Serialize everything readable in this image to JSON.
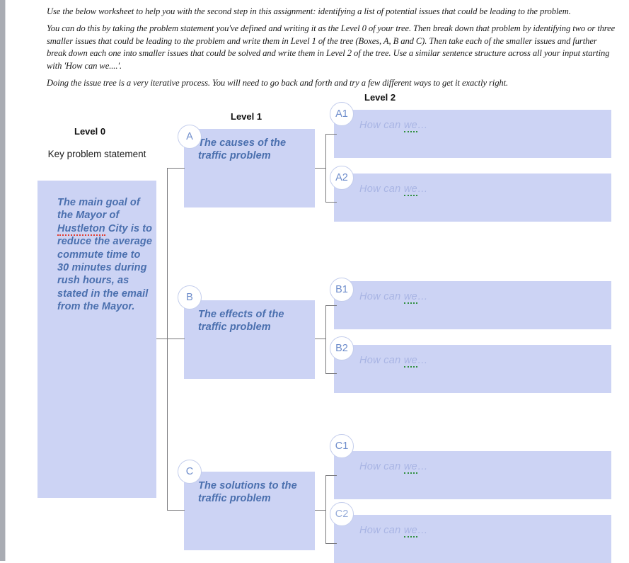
{
  "document": {
    "instructions": [
      "Use the below worksheet to help you with the second step in this assignment: identifying a list of potential issues that could be leading to the problem.",
      "You can do this by taking the problem statement you've defined and writing it as the Level 0 of your tree. Then break down that problem by identifying two or three smaller issues that could be leading to the problem and write them in Level 1 of the tree (Boxes, A, B and C). Then take each of the smaller issues and further break down each one into smaller issues that could be solved and write them in Level 2 of the tree. Use a similar sentence structure across all your input starting with 'How can we....'.",
      "Doing the issue tree is a very iterative process. You will need to go back and forth and try a few different ways to get it exactly right."
    ]
  },
  "tree": {
    "columns": {
      "level0_label": "Level 0",
      "level0_sublabel": "Key problem statement",
      "level1_label": "Level 1",
      "level2_label": "Level 2"
    },
    "level0": {
      "text_before": "The main goal of the Mayor of ",
      "misspelled_word": "Hustleton",
      "text_after": " City is to reduce the average commute time to 30 minutes during rush hours, as stated in the email from the Mayor."
    },
    "level1": [
      {
        "badge": "A",
        "text": "The causes of the traffic problem"
      },
      {
        "badge": "B",
        "text": "The effects of the traffic problem"
      },
      {
        "badge": "C",
        "text": "The solutions to the traffic problem"
      }
    ],
    "level2": [
      {
        "badge": "A1",
        "placeholder_start": "How can ",
        "placeholder_flagged": "we",
        "placeholder_end": "…"
      },
      {
        "badge": "A2",
        "placeholder_start": "How can ",
        "placeholder_flagged": "we",
        "placeholder_end": "…"
      },
      {
        "badge": "B1",
        "placeholder_start": "How can ",
        "placeholder_flagged": "we",
        "placeholder_end": "…"
      },
      {
        "badge": "B2",
        "placeholder_start": "How can ",
        "placeholder_flagged": "we",
        "placeholder_end": "…"
      },
      {
        "badge": "C1",
        "placeholder_start": "How can ",
        "placeholder_flagged": "we",
        "placeholder_end": "…"
      },
      {
        "badge": "C2",
        "placeholder_start": "How can ",
        "placeholder_flagged": "we",
        "placeholder_end": "…"
      }
    ]
  },
  "colors": {
    "box_fill": "#ccd3f4",
    "node_text": "#4a6fae",
    "placeholder_text": "#a9b5e4",
    "badge_border": "#c3cdec",
    "connector": "#77777a",
    "spellcheck_red": "#e03b2f",
    "grammarcheck_green": "#2f8f3e",
    "gutter": "#a9acb3"
  }
}
